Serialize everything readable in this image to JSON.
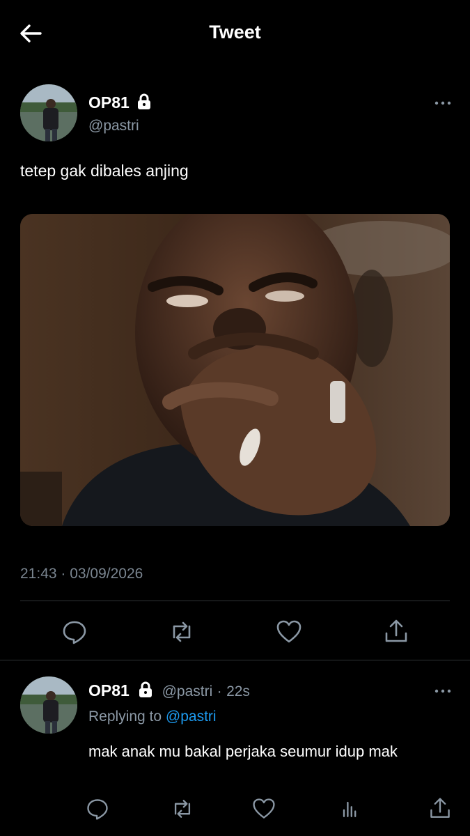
{
  "header": {
    "title": "Tweet"
  },
  "tweet": {
    "display_name": "OP81",
    "handle": "@pastri",
    "text": "tetep gak dibales anjing",
    "timestamp": "21:43 · 03/09/2026",
    "locked": true
  },
  "reply": {
    "display_name": "OP81",
    "handle": "@pastri",
    "separator": "·",
    "time_ago": "22s",
    "replying_prefix": "Replying to",
    "replying_to": "@pastri",
    "text": "mak anak mu bakal perjaka seumur idup mak"
  },
  "icons": {
    "back": "arrow-left-icon",
    "lock": "lock-icon",
    "more": "more-dots-icon",
    "reply": "comment-icon",
    "retweet": "retweet-icon",
    "like": "heart-icon",
    "share": "share-icon",
    "views": "bar-chart-icon"
  },
  "colors": {
    "background": "#000000",
    "link": "#1d9bf0",
    "secondary_text": "#8b98a5"
  }
}
